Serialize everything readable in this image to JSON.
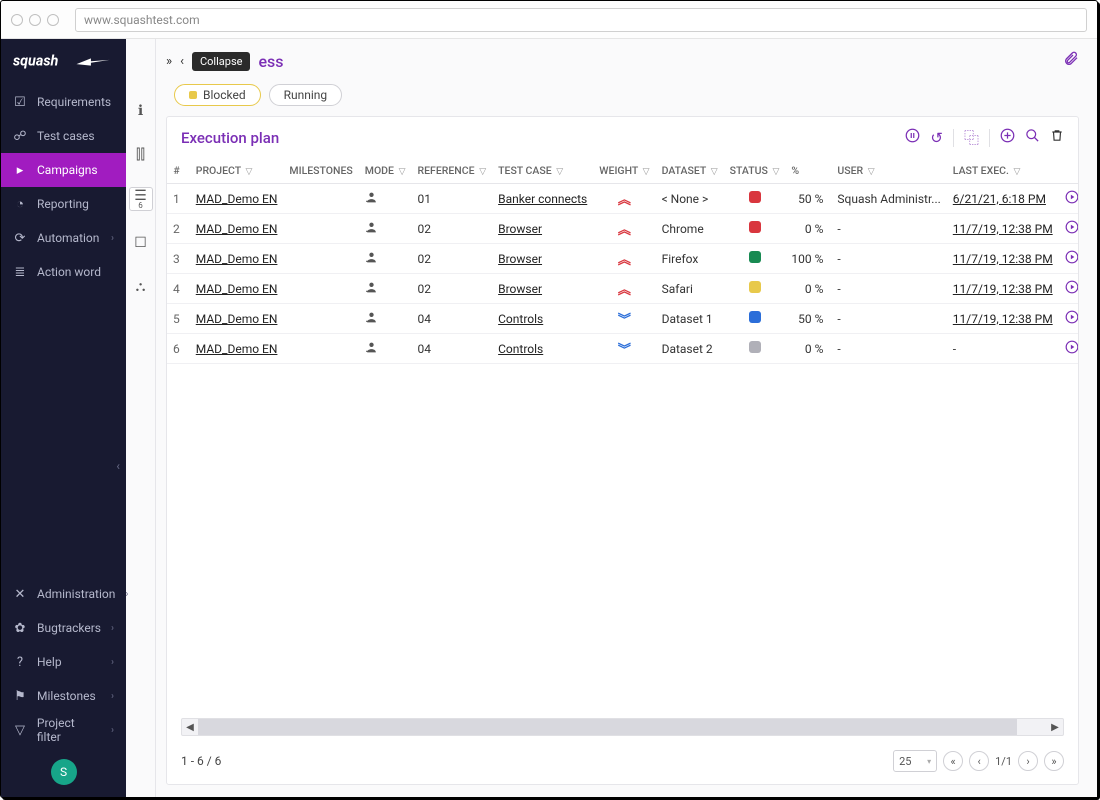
{
  "browser": {
    "url": "www.squashtest.com"
  },
  "brand": "squash",
  "tooltip": "Collapse",
  "title_fragment": "ess",
  "sidebar": {
    "top": [
      {
        "icon": "☑",
        "label": "Requirements",
        "expandable": false
      },
      {
        "icon": "☍",
        "label": "Test cases",
        "expandable": false
      },
      {
        "icon": "▸",
        "label": "Campaigns",
        "expandable": false,
        "active": true
      },
      {
        "icon": "◔",
        "label": "Reporting",
        "expandable": false
      },
      {
        "icon": "⟳",
        "label": "Automation",
        "expandable": true
      },
      {
        "icon": "≣",
        "label": "Action word",
        "expandable": false
      }
    ],
    "bottom": [
      {
        "icon": "✕",
        "label": "Administration",
        "expandable": true
      },
      {
        "icon": "✿",
        "label": "Bugtrackers",
        "expandable": true
      },
      {
        "icon": "?",
        "label": "Help",
        "expandable": true
      },
      {
        "icon": "⚑",
        "label": "Milestones",
        "expandable": true
      },
      {
        "icon": "▽",
        "label": "Project filter",
        "expandable": true
      }
    ],
    "avatar": "S"
  },
  "rail": [
    {
      "glyph": "ℹ",
      "name": "info"
    },
    {
      "glyph": "⫿⫿",
      "name": "chart"
    },
    {
      "glyph": "☰",
      "name": "list",
      "active": true,
      "badge": "6"
    },
    {
      "glyph": "☐",
      "name": "box"
    },
    {
      "glyph": "⛬",
      "name": "bug"
    }
  ],
  "status_pills": {
    "blocked": "Blocked",
    "running": "Running"
  },
  "panel": {
    "title": "Execution plan",
    "columns": [
      "#",
      "PROJECT",
      "MILESTONES",
      "MODE",
      "REFERENCE",
      "TEST CASE",
      "WEIGHT",
      "DATASET",
      "STATUS",
      "%",
      "USER",
      "LAST EXEC."
    ],
    "rows": [
      {
        "n": 1,
        "project": "MAD_Demo EN",
        "ref": "01",
        "tc": "Banker connects",
        "weight": "red-up",
        "dataset": "< None >",
        "status": "red",
        "pct": "50 %",
        "user": "Squash Administr...",
        "last": "6/21/21, 6:18 PM",
        "trail": "delete"
      },
      {
        "n": 2,
        "project": "MAD_Demo EN",
        "ref": "02",
        "tc": "Browser",
        "weight": "red-up",
        "dataset": "Chrome",
        "status": "red",
        "pct": "0 %",
        "user": "-",
        "last": "11/7/19, 12:38 PM",
        "trail": "delete"
      },
      {
        "n": 3,
        "project": "MAD_Demo EN",
        "ref": "02",
        "tc": "Browser",
        "weight": "red-up",
        "dataset": "Firefox",
        "status": "green",
        "pct": "100 %",
        "user": "-",
        "last": "11/7/19, 12:38 PM",
        "trail": "delete"
      },
      {
        "n": 4,
        "project": "MAD_Demo EN",
        "ref": "02",
        "tc": "Browser",
        "weight": "red-up",
        "dataset": "Safari",
        "status": "yellow",
        "pct": "0 %",
        "user": "-",
        "last": "11/7/19, 12:38 PM",
        "trail": "delete"
      },
      {
        "n": 5,
        "project": "MAD_Demo EN",
        "ref": "04",
        "tc": "Controls",
        "weight": "blue-down",
        "dataset": "Dataset 1",
        "status": "blue",
        "pct": "50 %",
        "user": "-",
        "last": "11/7/19, 12:38 PM",
        "trail": "delete"
      },
      {
        "n": 6,
        "project": "MAD_Demo EN",
        "ref": "04",
        "tc": "Controls",
        "weight": "blue-down",
        "dataset": "Dataset 2",
        "status": "grey",
        "pct": "0 %",
        "user": "-",
        "last": "-",
        "trail": "minus"
      }
    ]
  },
  "footer": {
    "count": "1 - 6 / 6",
    "page_size": "25",
    "page_label": "1/1"
  }
}
